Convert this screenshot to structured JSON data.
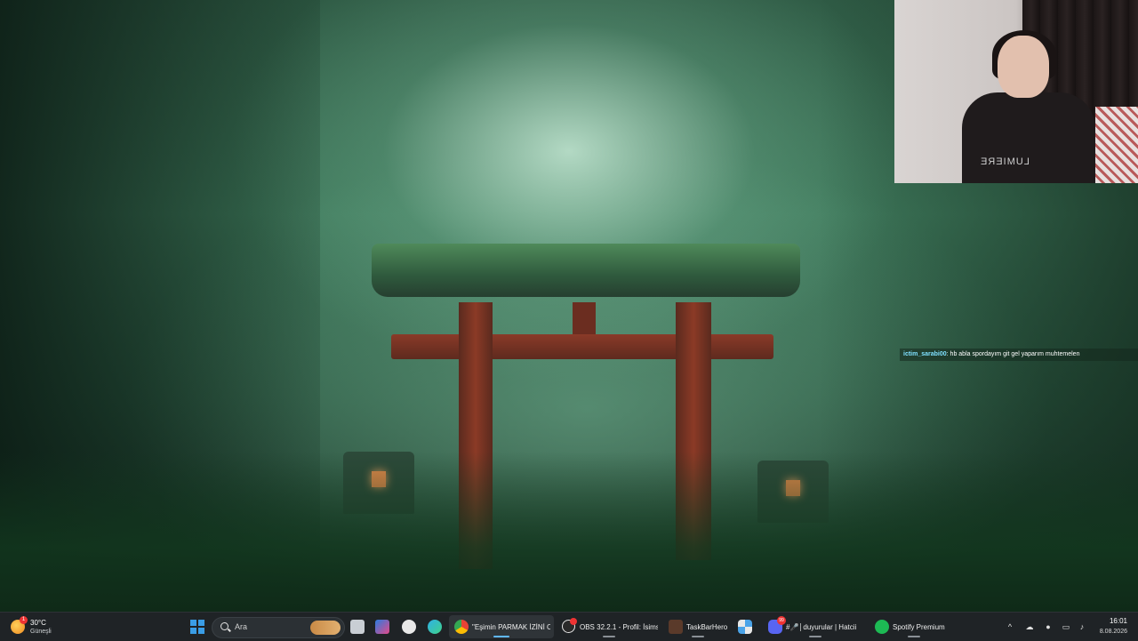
{
  "chat": {
    "username": "ictim_sarabi00",
    "message": ": hb abla spordayım git gel yaparım muhtemelen"
  },
  "webcam": {
    "shirt_text": "LUMIERE"
  },
  "taskbar": {
    "weather": {
      "temperature": "30°C",
      "condition": "Güneşli",
      "badge": "1",
      "icon": "sun-icon"
    },
    "search": {
      "placeholder": "Ara"
    },
    "apps": [
      {
        "name": "chrome",
        "label": "\"Eşimin PARMAK İZİNİ C",
        "active": true,
        "icon": "chrome-icon"
      },
      {
        "name": "obs",
        "label": "OBS 32.2.1 - Profil: İsimsi",
        "active": false,
        "icon": "obs-icon"
      },
      {
        "name": "taskbarhero",
        "label": "TaskBarHero",
        "active": false,
        "icon": "taskbarhero-icon"
      },
      {
        "name": "discord",
        "label": "#🎤│duyurular | Hatcii",
        "active": false,
        "icon": "discord-icon",
        "badge": "99"
      },
      {
        "name": "spotify",
        "label": "Spotify Premium",
        "active": false,
        "icon": "spotify-icon"
      }
    ],
    "clock": {
      "time": "16:01",
      "date": "8.08.2026"
    }
  },
  "colors": {
    "taskbar_bg": "#1f2326",
    "chat_user": "#7fe0ff",
    "accent": "#60b8ff"
  }
}
